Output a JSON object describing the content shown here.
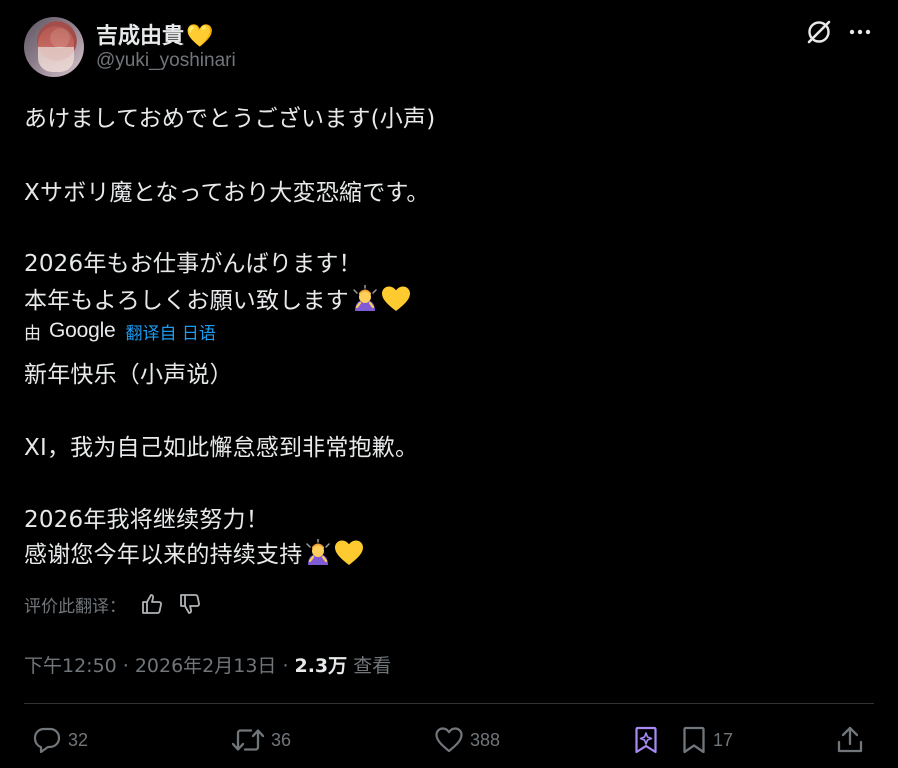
{
  "author": {
    "display_name": "吉成由貴",
    "name_emoji": "💛",
    "handle": "@yuki_yoshinari"
  },
  "post": {
    "original_lines": [
      "あけましておめでとうございます(小声)",
      "Xサボリ魔となっており大変恐縮です。",
      "2026年もお仕事がんばります！",
      "本年もよろしくお願い致します"
    ],
    "translation_by": "由",
    "translation_engine": "Google",
    "translated_from": "翻译自 日语",
    "translated_lines": [
      "新年快乐（小声说）",
      "XI，我为自己如此懈怠感到非常抱歉。",
      "2026年我将继续努力！",
      "感谢您今年以来的持续支持"
    ],
    "rate_translation_label": "评价此翻译："
  },
  "meta": {
    "time": "下午12:50",
    "date": "2026年2月13日",
    "separator": "·",
    "views_count": "2.3万",
    "views_label": "查看"
  },
  "actions": {
    "replies": "32",
    "reposts": "36",
    "likes": "388",
    "bookmarks": "17"
  },
  "icons": {
    "grok": "grok-icon",
    "more": "more-icon",
    "reply": "reply-icon",
    "repost": "repost-icon",
    "like": "heart-icon",
    "grok_analyze": "grok-analyze-icon",
    "bookmark": "bookmark-icon",
    "share": "share-icon"
  },
  "colors": {
    "background": "#000000",
    "text": "#e7e9ea",
    "muted": "#71767b",
    "link": "#1d9bf0",
    "heart_emoji": "#f9c22e",
    "accent_purple": "#a98bf5",
    "divider": "#2f3336"
  }
}
